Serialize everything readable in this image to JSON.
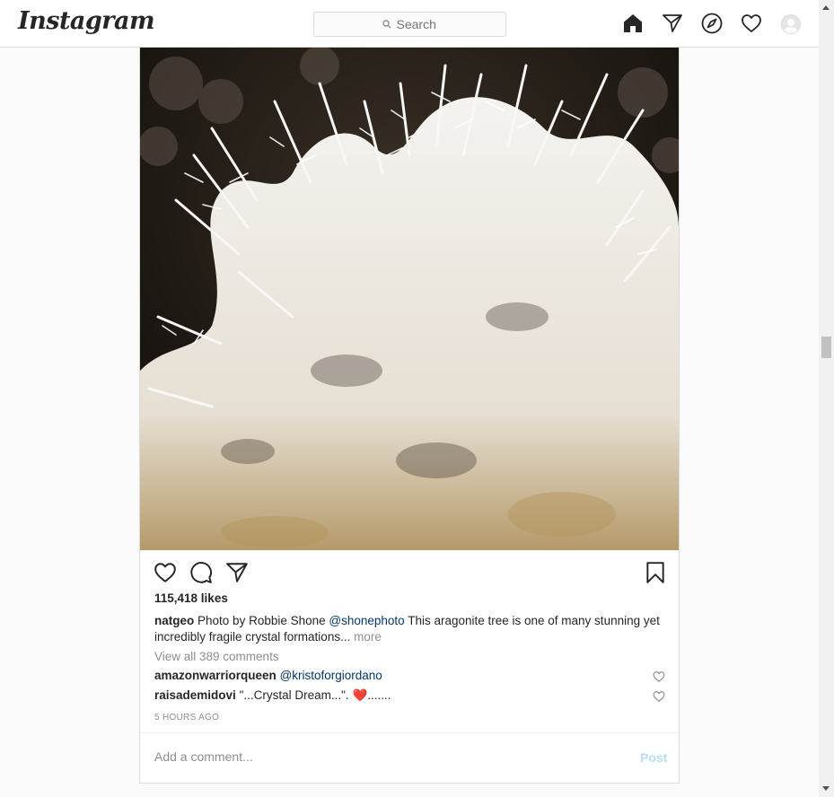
{
  "header": {
    "logo": "Instagram",
    "search_placeholder": "Search",
    "icons": [
      "home-icon",
      "direct-icon",
      "explore-icon",
      "activity-heart-icon",
      "profile-avatar"
    ]
  },
  "post": {
    "photo_alt": "aragonite tree crystal formation",
    "likes": "115,418 likes",
    "caption": {
      "username": "natgeo",
      "text_before": "Photo by Robbie Shone",
      "mention": "@shonephoto",
      "text_after": "This aragonite tree is one of many stunning yet incredibly fragile crystal formations...",
      "more": "more"
    },
    "view_all": "View all 389 comments",
    "comments": [
      {
        "username": "amazonwarriorqueen",
        "mention": "@kristoforgiordano",
        "text": ""
      },
      {
        "username": "raisademidovi",
        "mention": "",
        "text": "\"...Crystal Dream...\".",
        "emoji": "❤️",
        "trail": "......."
      }
    ],
    "timestamp": "5 HOURS AGO",
    "add_comment_placeholder": "Add a comment...",
    "post_button": "Post"
  },
  "colors": {
    "border": "#dbdbdb",
    "secondary_text": "#8e8e8e",
    "link": "#00376b",
    "post_button_disabled": "#b2dffc"
  }
}
